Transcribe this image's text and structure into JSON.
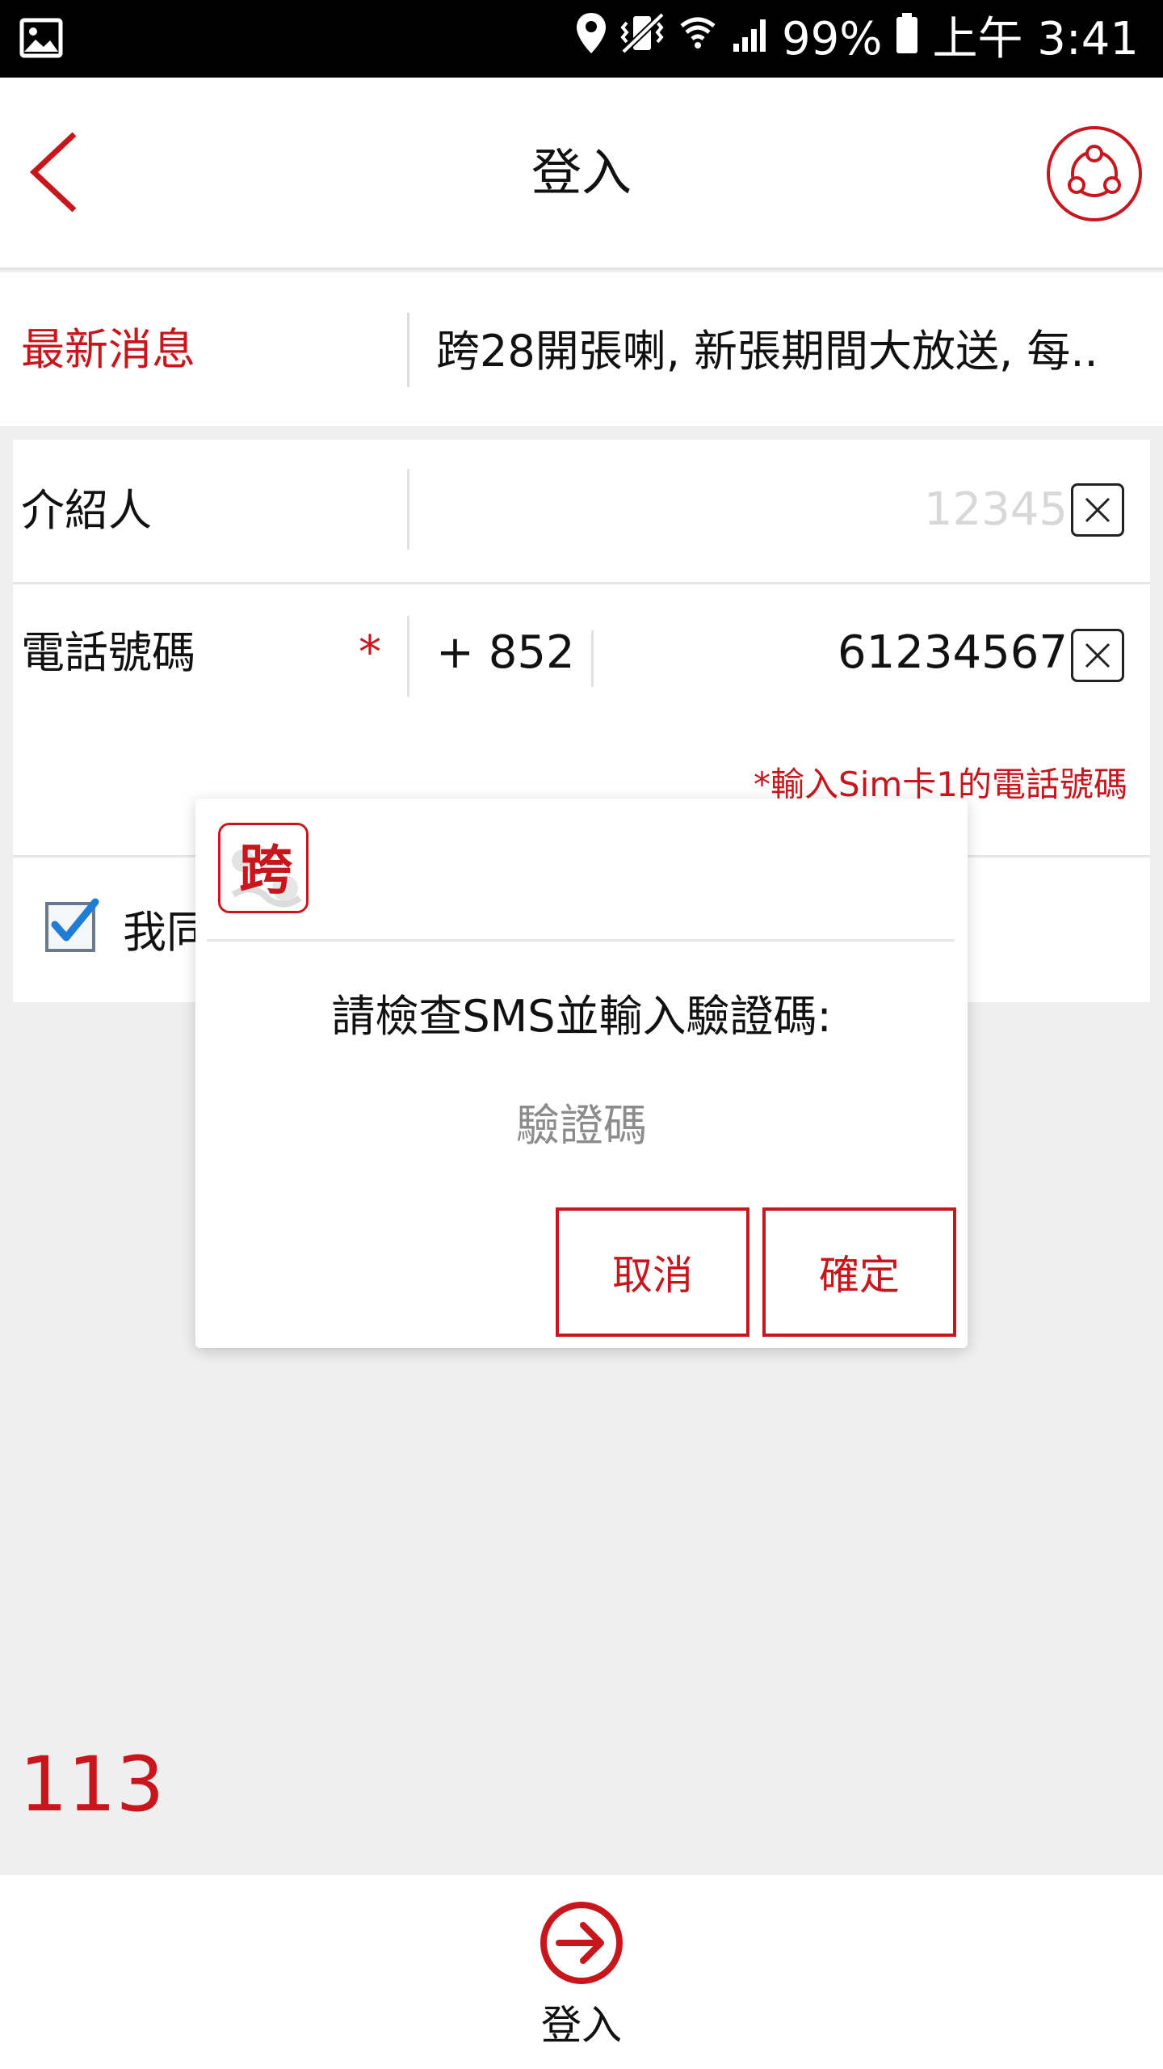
{
  "status_bar": {
    "battery": "99%",
    "time": "上午 3:41",
    "icons": [
      "image-icon",
      "location-icon",
      "vibrate-icon",
      "wifi-icon",
      "signal-icon",
      "battery-icon"
    ]
  },
  "header": {
    "title": "登入",
    "back_icon": "chevron-left-icon",
    "share_icon": "share-icon"
  },
  "news": {
    "label": "最新消息",
    "text": "跨28開張喇, 新張期間大放送, 每.."
  },
  "form": {
    "referrer_label": "介紹人",
    "referrer_placeholder": "12345",
    "referrer_value": "",
    "phone_label": "電話號碼",
    "required_mark": "*",
    "country_code": "+ 852",
    "phone_value": "61234567",
    "phone_hint": "*輸入Sim卡1的電話號碼",
    "agree_text": "我同",
    "agree_checked": true
  },
  "counter": "113",
  "bottom_bar": {
    "login_label": "登入",
    "login_icon": "arrow-circle-right-icon"
  },
  "dialog": {
    "logo_char": "跨",
    "message": "請檢查SMS並輸入驗證碼:",
    "code_placeholder": "驗證碼",
    "code_value": "",
    "cancel_label": "取消",
    "confirm_label": "確定"
  },
  "colors": {
    "accent": "#c8161d",
    "background": "#efefef",
    "surface": "#ffffff",
    "status_bar": "#000000"
  }
}
